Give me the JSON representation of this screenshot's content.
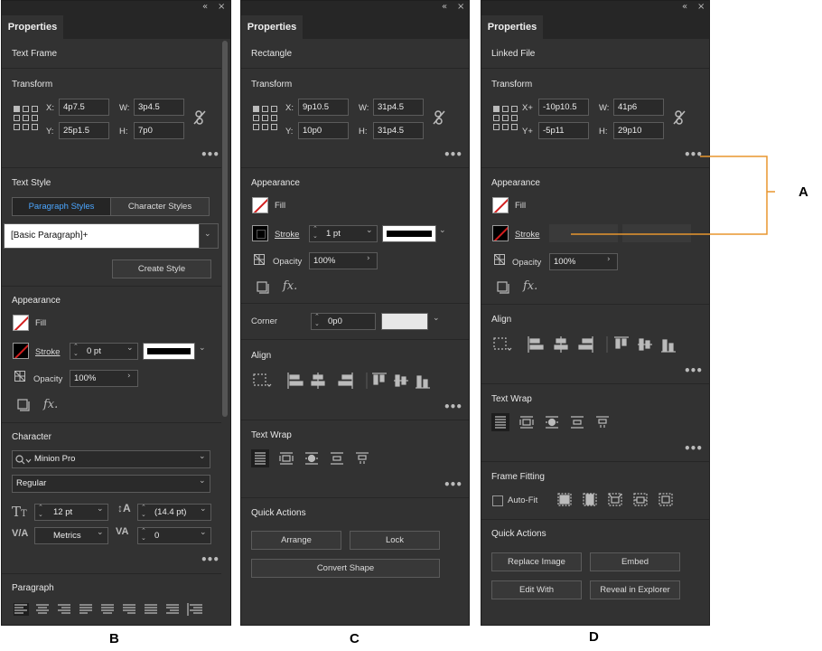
{
  "colors": {
    "panel": "#323232",
    "bar": "#262626",
    "accent": "#2d8ceb",
    "callout": "#e8962e",
    "fill_none_line": "#d21e1e"
  },
  "tab_label": "Properties",
  "panel_b": {
    "letter": "B",
    "object": "Text Frame",
    "transform": {
      "title": "Transform",
      "x_label": "X:",
      "x": "4p7.5",
      "y_label": "Y:",
      "y": "25p1.5",
      "w_label": "W:",
      "w": "3p4.5",
      "h_label": "H:",
      "h": "7p0"
    },
    "text_style": {
      "title": "Text Style",
      "tab_para": "Paragraph Styles",
      "tab_char": "Character Styles",
      "style_value": "[Basic Paragraph]+",
      "create": "Create Style"
    },
    "appearance": {
      "title": "Appearance",
      "fill": "Fill",
      "stroke": "Stroke",
      "stroke_weight": "0 pt",
      "opacity_label": "Opacity",
      "opacity": "100%"
    },
    "character": {
      "title": "Character",
      "font": "Minion Pro",
      "style": "Regular",
      "size": "12 pt",
      "leading": "(14.4 pt)",
      "kerning": "Metrics",
      "tracking": "0"
    },
    "paragraph": {
      "title": "Paragraph"
    }
  },
  "panel_c": {
    "letter": "C",
    "object": "Rectangle",
    "transform": {
      "title": "Transform",
      "x_label": "X:",
      "x": "9p10.5",
      "y_label": "Y:",
      "y": "10p0",
      "w_label": "W:",
      "w": "31p4.5",
      "h_label": "H:",
      "h": "31p4.5"
    },
    "appearance": {
      "title": "Appearance",
      "fill": "Fill",
      "stroke": "Stroke",
      "stroke_weight": "1 pt",
      "opacity_label": "Opacity",
      "opacity": "100%"
    },
    "corner": {
      "label": "Corner",
      "value": "0p0"
    },
    "align": {
      "title": "Align"
    },
    "text_wrap": {
      "title": "Text Wrap"
    },
    "quick_actions": {
      "title": "Quick Actions",
      "arrange": "Arrange",
      "lock": "Lock",
      "convert": "Convert Shape"
    }
  },
  "panel_d": {
    "letter": "D",
    "object": "Linked File",
    "transform": {
      "title": "Transform",
      "x_label": "X+",
      "x": "-10p10.5",
      "y_label": "Y+",
      "y": "-5p11",
      "w_label": "W:",
      "w": "41p6",
      "h_label": "H:",
      "h": "29p10"
    },
    "appearance": {
      "title": "Appearance",
      "fill": "Fill",
      "stroke": "Stroke",
      "opacity_label": "Opacity",
      "opacity": "100%"
    },
    "align": {
      "title": "Align"
    },
    "text_wrap": {
      "title": "Text Wrap"
    },
    "frame_fitting": {
      "title": "Frame Fitting",
      "autofit": "Auto-Fit"
    },
    "quick_actions": {
      "title": "Quick Actions",
      "replace": "Replace Image",
      "embed": "Embed",
      "edit_with": "Edit With",
      "reveal": "Reveal in Explorer"
    }
  },
  "callout": {
    "label": "A"
  },
  "icons": {
    "collapse": "«",
    "close": "×",
    "more": "•••",
    "fx": "fx."
  }
}
